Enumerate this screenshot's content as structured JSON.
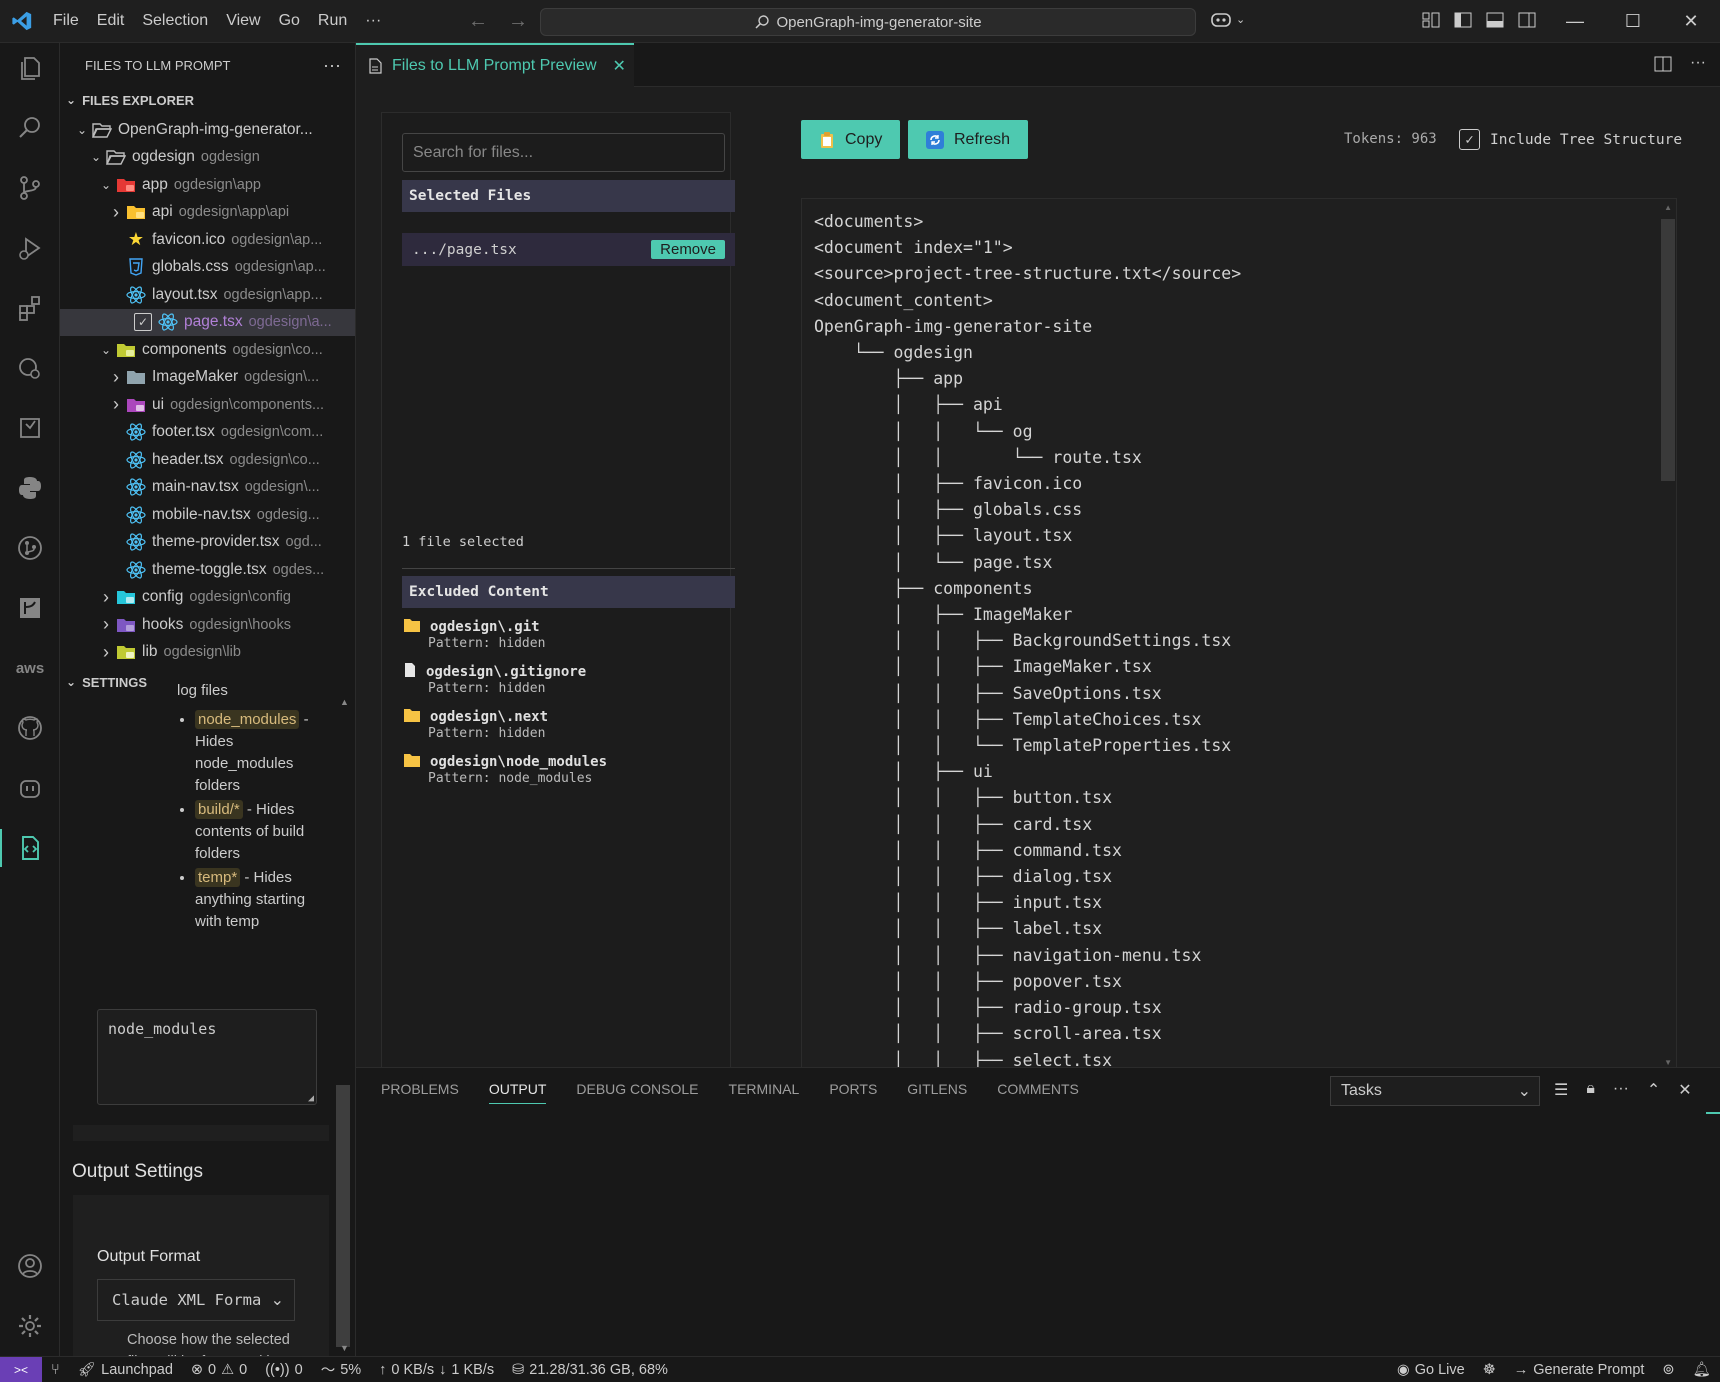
{
  "titlebar": {
    "menu": [
      "File",
      "Edit",
      "Selection",
      "View",
      "Go",
      "Run",
      "···"
    ],
    "search": "OpenGraph-img-generator-site"
  },
  "sidebar": {
    "title": "FILES TO LLM PROMPT",
    "explorer_header": "FILES EXPLORER",
    "tree": [
      {
        "name": "OpenGraph-img-generator...",
        "desc": "",
        "indent": 0,
        "chev": "v",
        "icon": "folder-open-icon"
      },
      {
        "name": "ogdesign",
        "desc": "ogdesign",
        "indent": 1,
        "chev": "v",
        "icon": "folder-open-icon"
      },
      {
        "name": "app",
        "desc": "ogdesign\\app",
        "indent": 2,
        "chev": "v",
        "icon": "folder-app-icon"
      },
      {
        "name": "api",
        "desc": "ogdesign\\app\\api",
        "indent": 3,
        "chev": ">",
        "icon": "folder-api-icon"
      },
      {
        "name": "favicon.ico",
        "desc": "ogdesign\\ap...",
        "indent": 3,
        "chev": "",
        "icon": "star-icon"
      },
      {
        "name": "globals.css",
        "desc": "ogdesign\\ap...",
        "indent": 3,
        "chev": "",
        "icon": "css-icon"
      },
      {
        "name": "layout.tsx",
        "desc": "ogdesign\\app...",
        "indent": 3,
        "chev": "",
        "icon": "react-icon"
      },
      {
        "name": "page.tsx",
        "desc": "ogdesign\\a...",
        "indent": 3,
        "chev": "",
        "icon": "react-icon",
        "checked": true
      },
      {
        "name": "components",
        "desc": "ogdesign\\co...",
        "indent": 2,
        "chev": "v",
        "icon": "folder-components-icon"
      },
      {
        "name": "ImageMaker",
        "desc": "ogdesign\\...",
        "indent": 3,
        "chev": ">",
        "icon": "folder-icon"
      },
      {
        "name": "ui",
        "desc": "ogdesign\\components...",
        "indent": 3,
        "chev": ">",
        "icon": "folder-ui-icon"
      },
      {
        "name": "footer.tsx",
        "desc": "ogdesign\\com...",
        "indent": 3,
        "chev": "",
        "icon": "react-icon"
      },
      {
        "name": "header.tsx",
        "desc": "ogdesign\\co...",
        "indent": 3,
        "chev": "",
        "icon": "react-icon"
      },
      {
        "name": "main-nav.tsx",
        "desc": "ogdesign\\...",
        "indent": 3,
        "chev": "",
        "icon": "react-icon"
      },
      {
        "name": "mobile-nav.tsx",
        "desc": "ogdesig...",
        "indent": 3,
        "chev": "",
        "icon": "react-icon"
      },
      {
        "name": "theme-provider.tsx",
        "desc": "ogd...",
        "indent": 3,
        "chev": "",
        "icon": "react-icon"
      },
      {
        "name": "theme-toggle.tsx",
        "desc": "ogdes...",
        "indent": 3,
        "chev": "",
        "icon": "react-icon"
      },
      {
        "name": "config",
        "desc": "ogdesign\\config",
        "indent": 2,
        "chev": ">",
        "icon": "folder-config-icon"
      },
      {
        "name": "hooks",
        "desc": "ogdesign\\hooks",
        "indent": 2,
        "chev": ">",
        "icon": "folder-hooks-icon"
      },
      {
        "name": "lib",
        "desc": "ogdesign\\lib",
        "indent": 2,
        "chev": ">",
        "icon": "folder-lib-icon"
      }
    ],
    "settings_header": "SETTINGS",
    "settings": {
      "log_files": "log files",
      "bullets": [
        {
          "chip": "node_modules",
          "text": " - Hides node_modules folders"
        },
        {
          "chip": "build/*",
          "text": " - Hides contents of build folders"
        },
        {
          "chip": "temp*",
          "text": " - Hides anything starting with temp"
        }
      ],
      "textarea_value": "node_modules",
      "output_title": "Output Settings",
      "output_format_label": "Output Format",
      "output_format_value": "Claude XML Format",
      "output_help": "Choose how the selected files will be formatted in the generated prompt"
    }
  },
  "tab": {
    "label": "Files to LLM Prompt Preview"
  },
  "preview_panel": {
    "search_placeholder": "Search for files...",
    "selected_header": "Selected Files",
    "selected_file": ".../page.tsx",
    "remove_label": "Remove",
    "selected_count": "1 file selected",
    "excluded_header": "Excluded Content",
    "excluded": [
      {
        "name": "ogdesign\\.git",
        "pattern": "Pattern: hidden",
        "icon": "folder-icon"
      },
      {
        "name": "ogdesign\\.gitignore",
        "pattern": "Pattern: hidden",
        "icon": "file-icon"
      },
      {
        "name": "ogdesign\\.next",
        "pattern": "Pattern: hidden",
        "icon": "folder-icon"
      },
      {
        "name": "ogdesign\\node_modules",
        "pattern": "Pattern: node_modules",
        "icon": "folder-icon"
      }
    ],
    "copy_label": "Copy",
    "refresh_label": "Refresh",
    "tokens": "Tokens: 963",
    "include_tree_label": "Include Tree Structure",
    "include_tree_checked": true,
    "content_lines": [
      "<documents>",
      "<document index=\"1\">",
      "<source>project-tree-structure.txt</source>",
      "<document_content>",
      "OpenGraph-img-generator-site",
      "    └── ogdesign",
      "        ├── app",
      "        │   ├── api",
      "        │   │   └── og",
      "        │   │       └── route.tsx",
      "        │   ├── favicon.ico",
      "        │   ├── globals.css",
      "        │   ├── layout.tsx",
      "        │   └── page.tsx",
      "        ├── components",
      "        │   ├── ImageMaker",
      "        │   │   ├── BackgroundSettings.tsx",
      "        │   │   ├── ImageMaker.tsx",
      "        │   │   ├── SaveOptions.tsx",
      "        │   │   ├── TemplateChoices.tsx",
      "        │   │   └── TemplateProperties.tsx",
      "        │   ├── ui",
      "        │   │   ├── button.tsx",
      "        │   │   ├── card.tsx",
      "        │   │   ├── command.tsx",
      "        │   │   ├── dialog.tsx",
      "        │   │   ├── input.tsx",
      "        │   │   ├── label.tsx",
      "        │   │   ├── navigation-menu.tsx",
      "        │   │   ├── popover.tsx",
      "        │   │   ├── radio-group.tsx",
      "        │   │   ├── scroll-area.tsx",
      "        │   │   ├── select.tsx"
    ]
  },
  "panel": {
    "tabs": [
      "PROBLEMS",
      "OUTPUT",
      "DEBUG CONSOLE",
      "TERMINAL",
      "PORTS",
      "GITLENS",
      "COMMENTS"
    ],
    "active_tab": "OUTPUT",
    "tasks_value": "Tasks"
  },
  "statusbar": {
    "launchpad": "Launchpad",
    "errors": "0",
    "warnings": "0",
    "ports": "0",
    "cpu": "5%",
    "net_up": "0 KB/s",
    "net_down": "1 KB/s",
    "memory": "21.28/31.36 GB, 68%",
    "go_live": "Go Live",
    "generate_prompt": "Generate Prompt"
  },
  "colors": {
    "accent": "#4ec9b0",
    "remote": "#6a3fb5",
    "selected_text": "#b180d7"
  }
}
